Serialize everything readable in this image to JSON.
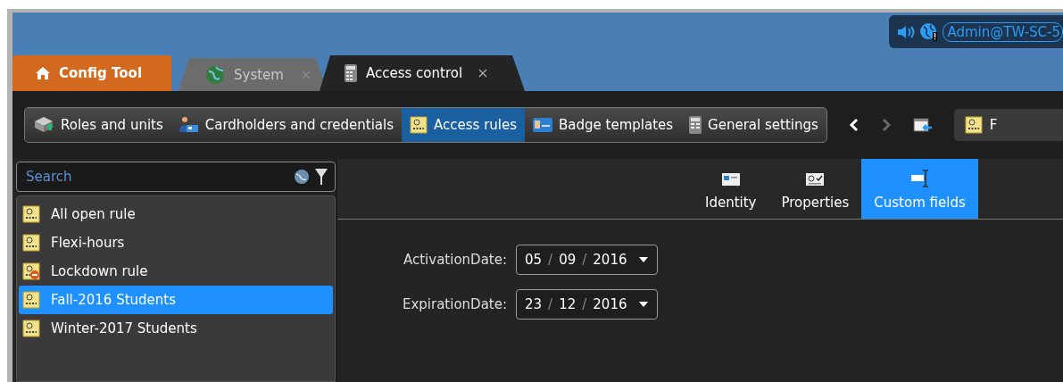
{
  "status": {
    "user": "Admin@TW-SC-5"
  },
  "tabs": [
    {
      "label": "Config Tool",
      "kind": "home",
      "selected": false
    },
    {
      "label": "System",
      "kind": "system",
      "selected": false
    },
    {
      "label": "Access control",
      "kind": "access",
      "selected": true
    }
  ],
  "toolbar": [
    {
      "label": "Roles and units",
      "kind": "roles",
      "selected": false
    },
    {
      "label": "Cardholders and credentials",
      "kind": "cardholder",
      "selected": false
    },
    {
      "label": "Access rules",
      "kind": "rule",
      "selected": true
    },
    {
      "label": "Badge templates",
      "kind": "badge",
      "selected": false
    },
    {
      "label": "General settings",
      "kind": "device",
      "selected": false
    }
  ],
  "nav": {
    "back_disabled": false,
    "forward_disabled": true
  },
  "shortcut": {
    "label": "F"
  },
  "search": {
    "placeholder": "Search"
  },
  "rules": [
    {
      "label": "All open rule",
      "blocked": false,
      "selected": false
    },
    {
      "label": "Flexi-hours",
      "blocked": false,
      "selected": false
    },
    {
      "label": "Lockdown rule",
      "blocked": true,
      "selected": false
    },
    {
      "label": "Fall-2016 Students",
      "blocked": false,
      "selected": true
    },
    {
      "label": "Winter-2017 Students",
      "blocked": false,
      "selected": false
    }
  ],
  "views": [
    {
      "label": "Identity",
      "kind": "identity",
      "selected": false
    },
    {
      "label": "Properties",
      "kind": "properties",
      "selected": false
    },
    {
      "label": "Custom fields",
      "kind": "custom",
      "selected": true
    }
  ],
  "fields": [
    {
      "label": "ActivationDate:",
      "parts": [
        "05",
        "/",
        "09",
        "/",
        "2016"
      ]
    },
    {
      "label": "ExpirationDate:",
      "parts": [
        "23",
        "/",
        "12",
        "/",
        "2016"
      ]
    }
  ]
}
